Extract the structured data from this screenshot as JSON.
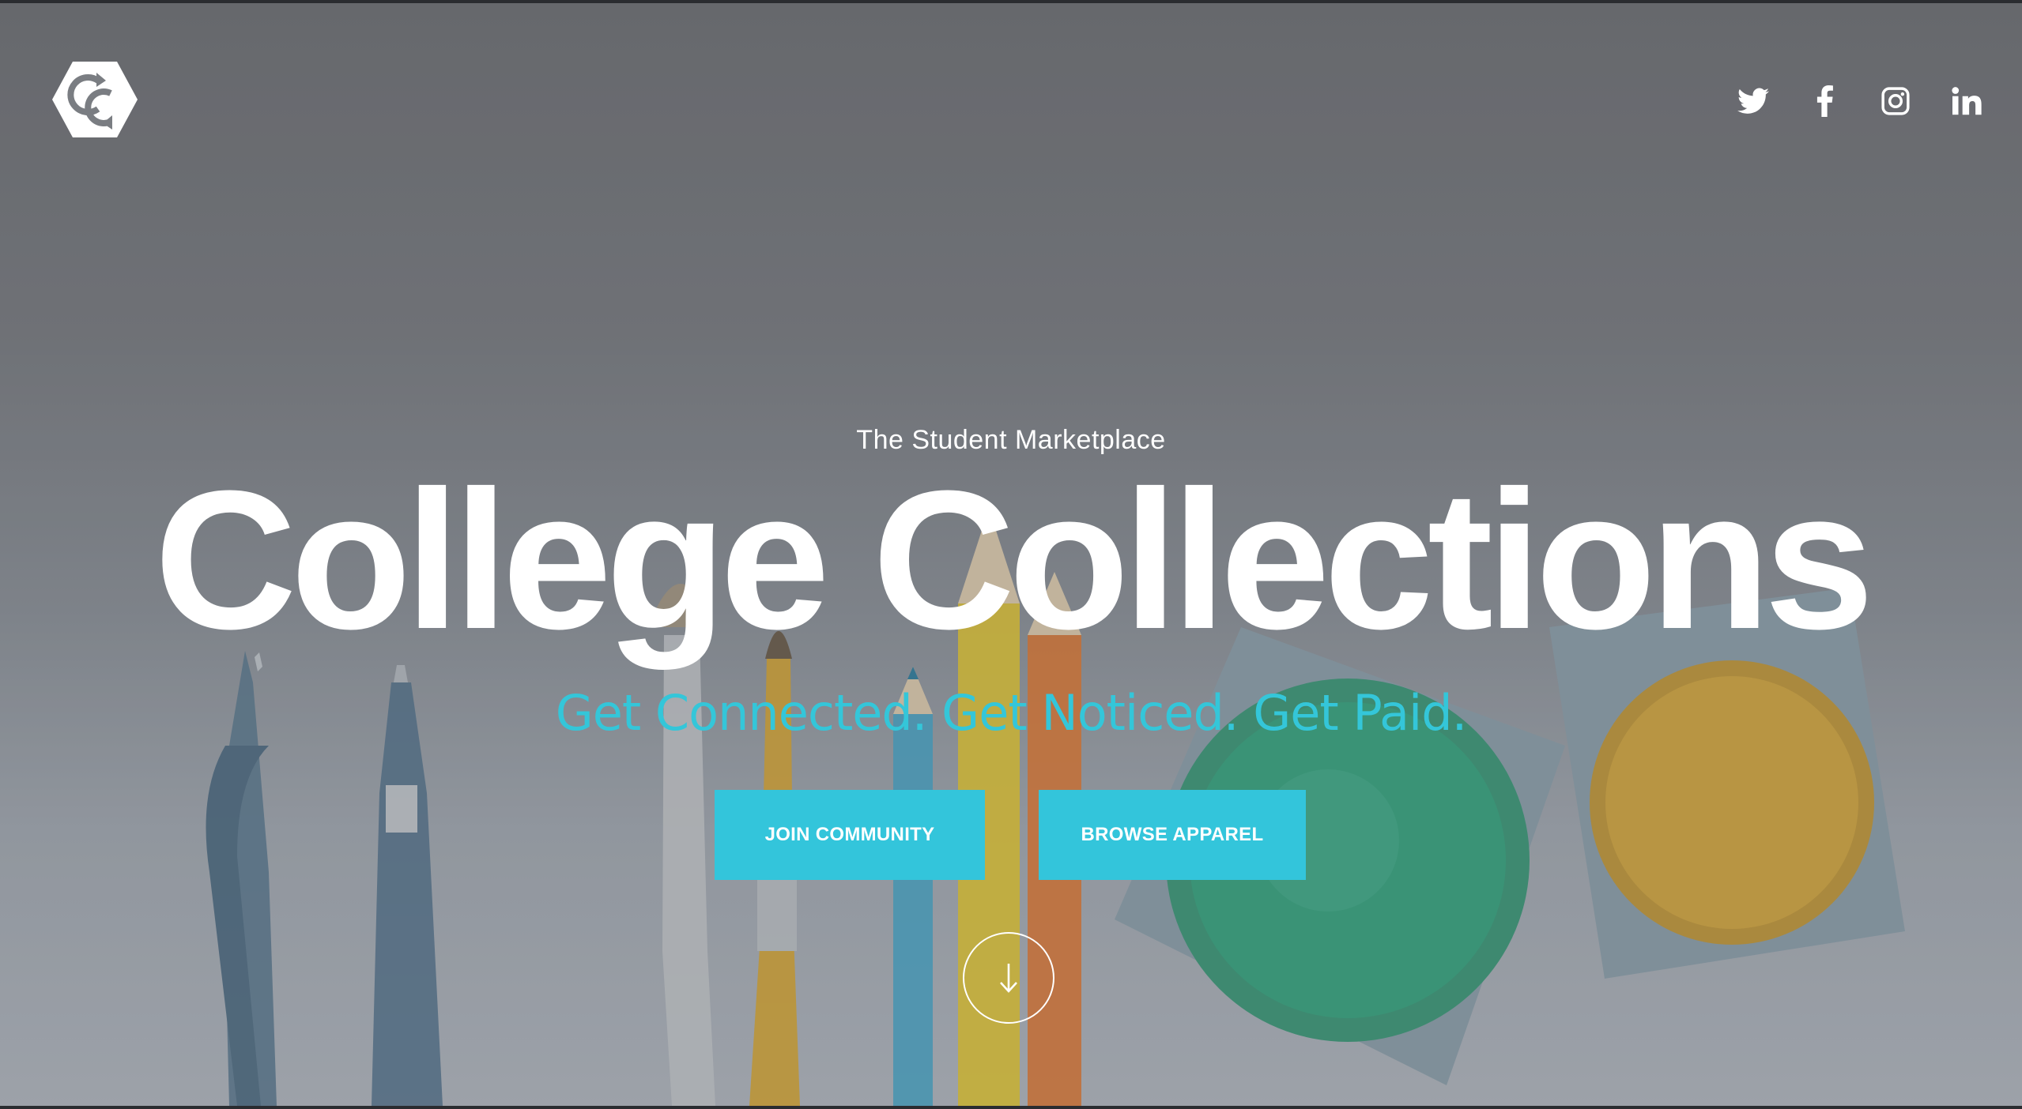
{
  "brand": {
    "logo_icon": "hexagon-cc-logo-icon"
  },
  "social": [
    {
      "name": "twitter",
      "icon": "twitter-icon"
    },
    {
      "name": "facebook",
      "icon": "facebook-icon"
    },
    {
      "name": "instagram",
      "icon": "instagram-icon"
    },
    {
      "name": "linkedin",
      "icon": "linkedin-icon"
    }
  ],
  "hero": {
    "tagline": "The Student Marketplace",
    "title": "College Collections",
    "subtitle": "Get Connected. Get Noticed. Get Paid.",
    "buttons": {
      "join": "JOIN COMMUNITY",
      "browse": "BROWSE APPAREL"
    },
    "scroll_icon": "arrow-down-icon"
  },
  "colors": {
    "accent": "#33c5db",
    "text": "#ffffff",
    "background": "#7a7d82"
  }
}
